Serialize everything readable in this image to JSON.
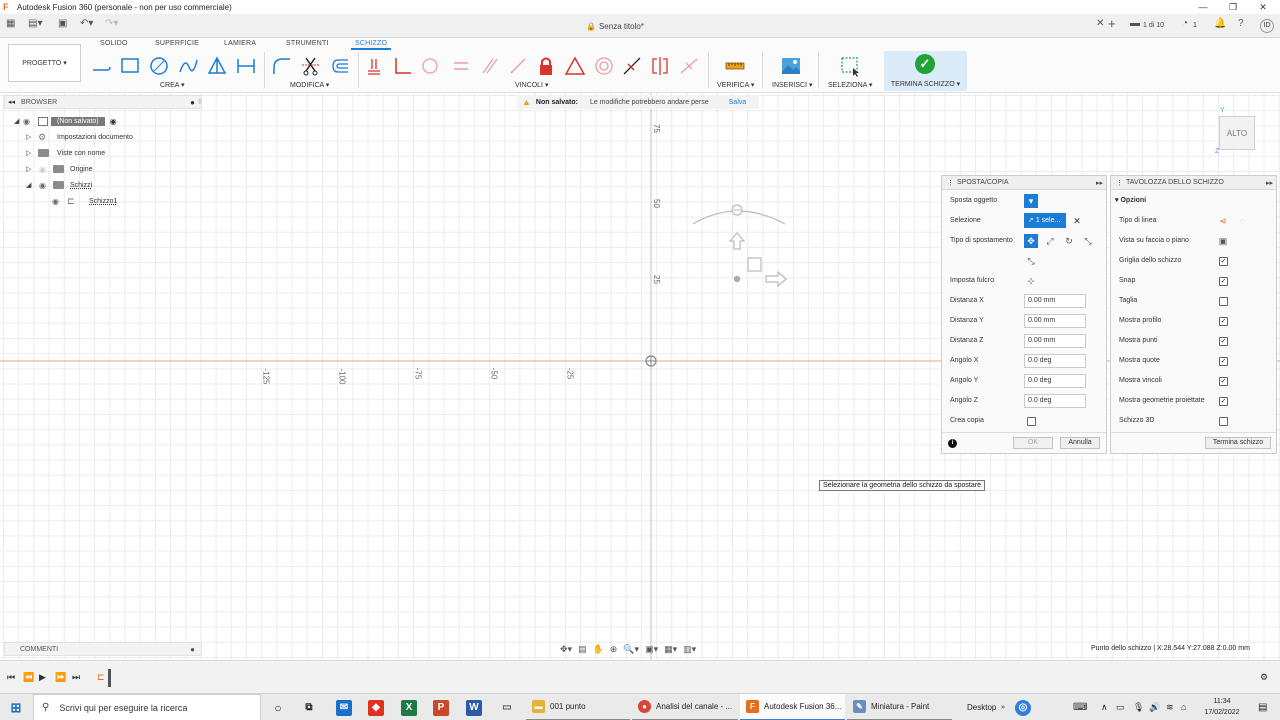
{
  "window": {
    "title": "Autodesk Fusion 360 (personale - non per uso commerciale)",
    "icon": "fusion-logo-icon",
    "controls": [
      "—",
      "❐",
      "✕"
    ]
  },
  "appbar": {
    "doc_title": "Senza titolo*",
    "tab_count": "1 di 10",
    "jobs_count": "1",
    "user_initials": "ID"
  },
  "toolbar": {
    "tabs": [
      "SOLIDO",
      "SUPERFICIE",
      "LAMIERA",
      "STRUMENTI",
      "SCHIZZO"
    ],
    "active_tab": "SCHIZZO",
    "project_label": "PROGETTO ▾",
    "groups": {
      "crea": "CREA ▾",
      "modifica": "MODIFICA ▾",
      "vincoli": "VINCOLI ▾",
      "verifica": "VERIFICA ▾",
      "inserisci": "INSERISCI ▾",
      "seleziona": "SELEZIONA ▾",
      "termina": "TERMINA SCHIZZO ▾"
    }
  },
  "warning": {
    "bold": "Non salvato:",
    "text": "Le modifiche potrebbero andare perse",
    "link": "Salva"
  },
  "browser": {
    "title": "BROWSER",
    "items": [
      {
        "label": "(Non salvato)"
      },
      {
        "label": "Impostazioni documento"
      },
      {
        "label": "Viste con nome"
      },
      {
        "label": "Origine"
      },
      {
        "label": "Schizzi"
      },
      {
        "label": "Schizzo1"
      }
    ]
  },
  "comments": {
    "title": "COMMENTI"
  },
  "canvas": {
    "x_ticks": [
      "-125",
      "-100",
      "-75",
      "-50",
      "-25"
    ],
    "y_ticks": [
      "75",
      "50",
      "25"
    ],
    "view_cube": "ALTO",
    "axis_y": "Y",
    "axis_z": "Z"
  },
  "move_panel": {
    "title": "SPOSTA/COPIA",
    "rows": {
      "sposta_oggetto": "Sposta oggetto",
      "selezione": "Selezione",
      "selezione_value": "1 sele...",
      "tipo_spostamento": "Tipo di spostamento",
      "imposta_fulcro": "Imposta fulcro",
      "distanza_x": "Distanza X",
      "distanza_y": "Distanza Y",
      "distanza_z": "Distanza Z",
      "angolo_x": "Angolo X",
      "angolo_y": "Angolo Y",
      "angolo_z": "Angolo Z",
      "crea_copia": "Crea copia"
    },
    "values": {
      "distanza_x": "0.00 mm",
      "distanza_y": "0.00 mm",
      "distanza_z": "0.00 mm",
      "angolo_x": "0.0 deg",
      "angolo_y": "0.0 deg",
      "angolo_z": "0.0 deg"
    },
    "ok": "OK",
    "cancel": "Annulla"
  },
  "palette_panel": {
    "title": "TAVOLOZZA DELLO SCHIZZO",
    "section": "Opzioni",
    "rows": [
      {
        "label": "Tipo di linea",
        "kind": "icons"
      },
      {
        "label": "Vista su faccia o piano",
        "kind": "icon"
      },
      {
        "label": "Griglia dello schizzo",
        "checked": true
      },
      {
        "label": "Snap",
        "checked": true
      },
      {
        "label": "Taglia",
        "checked": false
      },
      {
        "label": "Mostra profilo",
        "checked": true
      },
      {
        "label": "Mostra punti",
        "checked": true
      },
      {
        "label": "Mostra quote",
        "checked": true
      },
      {
        "label": "Mostra vincoli",
        "checked": true
      },
      {
        "label": "Mostra geometrie proiettate",
        "checked": true
      },
      {
        "label": "Schizzo 3D",
        "checked": false
      }
    ],
    "finish_button": "Termina schizzo"
  },
  "tooltip": "Selezionare la geometria dello schizzo da spostare",
  "status_coords": "Punto dello schizzo | X:28.544 Y:27.088 Z:0.00 mm",
  "taskbar": {
    "search_placeholder": "Scrivi qui per eseguire la ricerca",
    "apps": [
      "001 punto",
      "Analisi del canale - ...",
      "Autodesk Fusion 36...",
      "Miniatura - Paint"
    ],
    "desktop": "Desktop",
    "time": "11:34",
    "date": "17/02/2022"
  },
  "colors": {
    "accent": "#1b7dd5",
    "check_green": "#21a336",
    "warning": "#e8a317",
    "constraint_red": "#d9332e",
    "fusion_orange": "#e66d1b"
  }
}
